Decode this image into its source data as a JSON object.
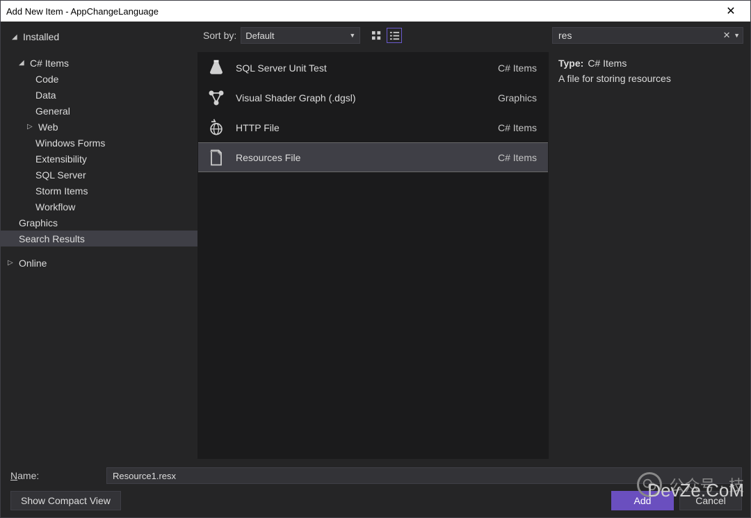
{
  "title": "Add New Item - AppChangeLanguage",
  "tree": {
    "installed": "Installed",
    "csitems": "C# Items",
    "children": [
      "Code",
      "Data",
      "General",
      "Web",
      "Windows Forms",
      "Extensibility",
      "SQL Server",
      "Storm Items",
      "Workflow"
    ],
    "graphics": "Graphics",
    "search_results": "Search Results",
    "online": "Online"
  },
  "sort": {
    "label": "Sort by:",
    "value": "Default"
  },
  "search": {
    "value": "res"
  },
  "items": [
    {
      "name": "SQL Server Unit Test",
      "category": "C# Items",
      "icon": "flask"
    },
    {
      "name": "Visual Shader Graph (.dgsl)",
      "category": "Graphics",
      "icon": "nodes"
    },
    {
      "name": "HTTP File",
      "category": "C# Items",
      "icon": "globe"
    },
    {
      "name": "Resources File",
      "category": "C# Items",
      "icon": "doc",
      "selected": true
    }
  ],
  "details": {
    "type_label": "Type:",
    "type_value": "C# Items",
    "description": "A file for storing resources"
  },
  "name_field": {
    "label": "Name:",
    "value": "Resource1.resx"
  },
  "buttons": {
    "compact": "Show Compact View",
    "add": "Add",
    "cancel": "Cancel"
  },
  "watermark": {
    "text1": "公众号 · 技",
    "text2": "DevZe.CoM"
  }
}
